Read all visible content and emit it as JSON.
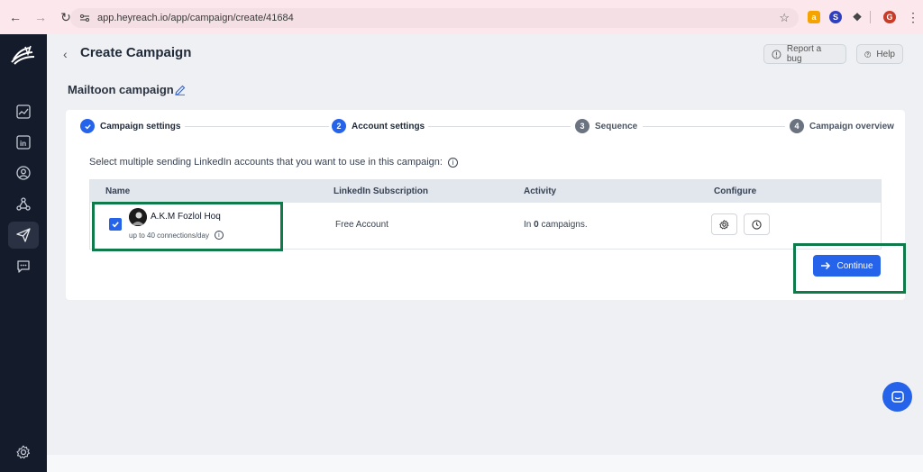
{
  "browser": {
    "url": "app.heyreach.io/app/campaign/create/41684",
    "ext_avatar_letter": "G"
  },
  "sidebar": {
    "icons": [
      "chart-icon",
      "linkedin-icon",
      "user-icon",
      "network-icon",
      "send-icon",
      "chat-icon",
      "settings-icon"
    ],
    "active": "send-icon"
  },
  "header": {
    "title": "Create Campaign",
    "report_label": "Report a bug",
    "help_label": "Help"
  },
  "campaign": {
    "name": "Mailtoon campaign"
  },
  "steps": [
    {
      "number": "1",
      "label": "Campaign settings",
      "state": "done"
    },
    {
      "number": "2",
      "label": "Account settings",
      "state": "current"
    },
    {
      "number": "3",
      "label": "Sequence",
      "state": "upcoming"
    },
    {
      "number": "4",
      "label": "Campaign overview",
      "state": "upcoming"
    }
  ],
  "instruction": "Select multiple sending LinkedIn accounts that you want to use in this campaign:",
  "table": {
    "headers": [
      "Name",
      "LinkedIn Subscription",
      "Activity",
      "Configure"
    ],
    "rows": [
      {
        "checked": true,
        "name": "A.K.M Fozlol Hoq",
        "limit": "up to 40 connections/day",
        "subscription": "Free Account",
        "activity_prefix": "In",
        "activity_count": "0",
        "activity_suffix": "campaigns."
      }
    ]
  },
  "continue_label": "Continue",
  "colors": {
    "accent": "#2563eb",
    "highlight": "#0f7a4a",
    "sidebar_bg": "#141b2b"
  }
}
